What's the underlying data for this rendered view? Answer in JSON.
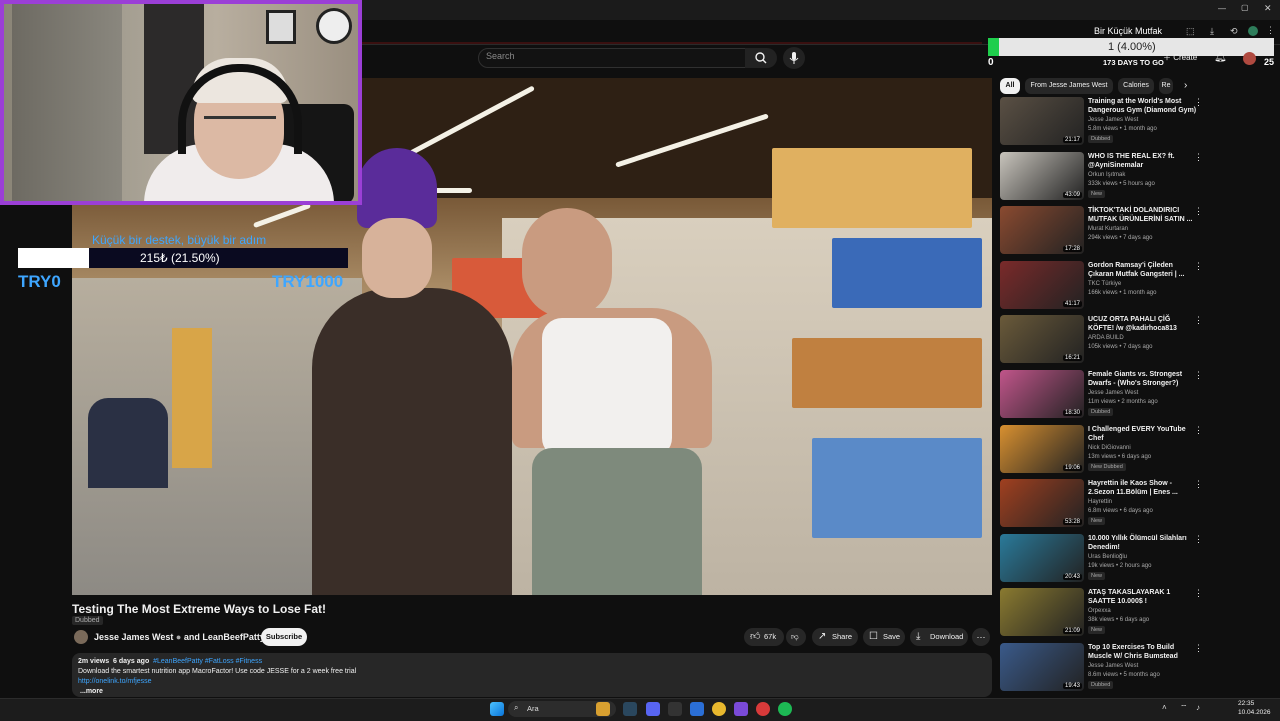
{
  "overlay": {
    "donation_title": "Küçük bir destek, büyük bir adım",
    "donation_amount": "215₺ (21.50%)",
    "goal_start": "TRY0",
    "goal_end": "TRY1000"
  },
  "goal": {
    "title": "Bir Küçük Mutfak",
    "value": "1 (4.00%)",
    "days": "173 DAYS TO GO",
    "start": "0",
    "end": "25",
    "progress_percent": 4
  },
  "search": {
    "placeholder": "Search"
  },
  "header": {
    "create_label": "Create"
  },
  "video": {
    "title": "Testing The Most Extreme Ways to Lose Fat!",
    "badge": "Dubbed",
    "channel": "Jesse James West",
    "channel_suffix": "and LeanBeefPatty",
    "subscribe": "Subscribe",
    "likes": "67k",
    "share": "Share",
    "save": "Save",
    "download": "Download",
    "views": "2m views",
    "age": "6 days ago",
    "tags": "#LeanBeefPatty #FatLoss #Fitness",
    "desc_line": "Download the smartest nutrition app MacroFactor! Use code JESSE for a 2 week free trial",
    "desc_link": "http://onelink.to/mfjesse",
    "more": "...more"
  },
  "chips": [
    "All",
    "From Jesse James West",
    "Calories",
    "Re"
  ],
  "related": [
    {
      "title": "Training at the World's Most Dangerous Gym (Diamond Gym)",
      "channel": "Jesse James West",
      "meta": "5.8m views • 1 month ago",
      "badge": "Dubbed",
      "duration": "21:17",
      "color": "#5a5044"
    },
    {
      "title": "WHO IS THE REAL EX? ft. @AyniSinemalar",
      "channel": "Orkun Işıtmak",
      "meta": "333k views • 5 hours ago",
      "badge": "New",
      "duration": "43:09",
      "color": "#c8c4bc"
    },
    {
      "title": "TİKTOK'TAKİ DOLANDIRICI MUTFAK ÜRÜNLERİNİ SATIN ...",
      "channel": "Murat Kurtaran",
      "meta": "294k views • 7 days ago",
      "badge": "",
      "duration": "17:28",
      "color": "#8a4a30"
    },
    {
      "title": "Gordon Ramsay'i Çileden Çıkaran Mutfak Gangsteri | ...",
      "channel": "TKC Türkiye",
      "meta": "166k views • 1 month ago",
      "badge": "",
      "duration": "41:17",
      "color": "#7a2a2a"
    },
    {
      "title": "UCUZ ORTA PAHALI ÇİĞ KÖFTE! /w @kadirhoca813",
      "channel": "ARDA BUILD",
      "meta": "105k views • 7 days ago",
      "badge": "",
      "duration": "16:21",
      "color": "#6a5a3a"
    },
    {
      "title": "Female Giants vs. Strongest Dwarfs - (Who's Stronger?)",
      "channel": "Jesse James West",
      "meta": "11m views • 2 months ago",
      "badge": "Dubbed",
      "duration": "18:30",
      "color": "#c0558a"
    },
    {
      "title": "I Challenged EVERY YouTube Chef",
      "channel": "Nick DiGiovanni",
      "meta": "13m views • 6 days ago",
      "badge": "New  Dubbed",
      "duration": "19:06",
      "color": "#d89030"
    },
    {
      "title": "Hayrettin ile Kaos Show - 2.Sezon 11.Bölüm | Enes ...",
      "channel": "Hayrettin",
      "meta": "6.8m views • 6 days ago",
      "badge": "New",
      "duration": "53:28",
      "color": "#a04020"
    },
    {
      "title": "10.000 Yıllık Ölümcül Silahları Denedim!",
      "channel": "Uras Benlioğlu",
      "meta": "19k views • 2 hours ago",
      "badge": "New",
      "duration": "20:43",
      "color": "#2a7a9a"
    },
    {
      "title": "ATAŞ TAKASLAYARAK 1 SAATTE 10.000$ !",
      "channel": "Orpexxa",
      "meta": "38k views • 6 days ago",
      "badge": "New",
      "duration": "21:09",
      "color": "#8a7a30"
    },
    {
      "title": "Top 10 Exercises To Build Muscle W/ Chris Bumstead",
      "channel": "Jesse James West",
      "meta": "8.6m views • 5 months ago",
      "badge": "Dubbed",
      "duration": "19:43",
      "color": "#3a5a8a"
    }
  ],
  "taskbar": {
    "search_label": "Ara",
    "time": "22:35",
    "date": "10.04.2026"
  }
}
